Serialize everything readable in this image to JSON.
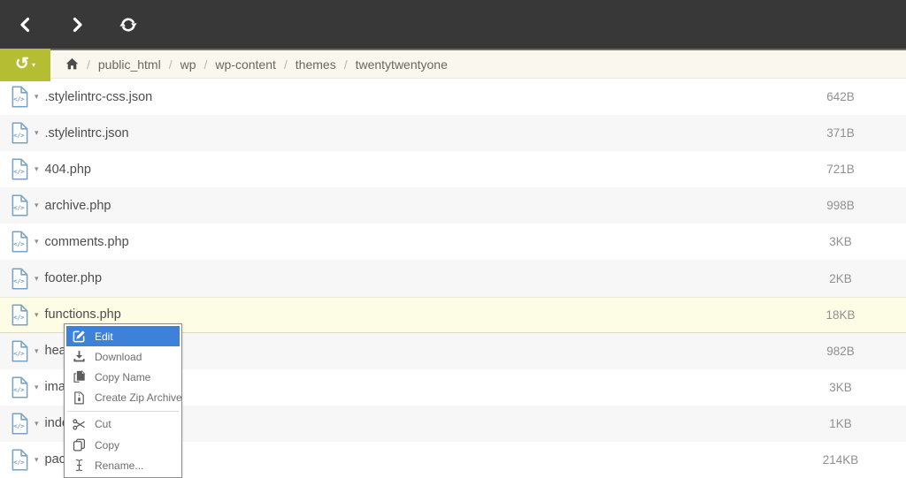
{
  "toolbar": {
    "buttons": [
      {
        "name": "back",
        "icon": "back-arrow-icon"
      },
      {
        "name": "forward",
        "icon": "forward-arrow-icon"
      },
      {
        "name": "refresh",
        "icon": "refresh-icon"
      }
    ]
  },
  "path_bar": {
    "history_button": {
      "icon": "history-icon",
      "caret": "▾"
    },
    "home_icon": "home-icon",
    "separator": "/",
    "segments": [
      "public_html",
      "wp",
      "wp-content",
      "themes",
      "twentytwentyone"
    ]
  },
  "file_list": {
    "caret_glyph": "▾",
    "rows": [
      {
        "name": ".stylelintrc-css.json",
        "size": "642B",
        "highlighted": false
      },
      {
        "name": ".stylelintrc.json",
        "size": "371B",
        "highlighted": false
      },
      {
        "name": "404.php",
        "size": "721B",
        "highlighted": false
      },
      {
        "name": "archive.php",
        "size": "998B",
        "highlighted": false
      },
      {
        "name": "comments.php",
        "size": "3KB",
        "highlighted": false
      },
      {
        "name": "footer.php",
        "size": "2KB",
        "highlighted": false
      },
      {
        "name": "functions.php",
        "size": "18KB",
        "highlighted": true
      },
      {
        "name": "head",
        "size": "982B",
        "highlighted": false
      },
      {
        "name": "imag",
        "size": "3KB",
        "highlighted": false
      },
      {
        "name": "inde",
        "size": "1KB",
        "highlighted": false
      },
      {
        "name": "pack",
        "size": "214KB",
        "highlighted": false
      }
    ]
  },
  "context_menu": {
    "items": [
      {
        "label": "Edit",
        "icon": "edit-icon",
        "active": true
      },
      {
        "label": "Download",
        "icon": "download-icon",
        "active": false
      },
      {
        "label": "Copy Name",
        "icon": "copy-name-icon",
        "active": false
      },
      {
        "label": "Create Zip Archive",
        "icon": "create-zip-archive-icon",
        "active": false
      },
      {
        "divider": true
      },
      {
        "label": "Cut",
        "icon": "cut-icon",
        "active": false
      },
      {
        "label": "Copy",
        "icon": "copy-icon",
        "active": false
      },
      {
        "label": "Rename...",
        "icon": "rename-icon",
        "active": false
      }
    ]
  },
  "colors": {
    "topbar_bg": "#383838",
    "accent_green": "#b5bd33",
    "breadcrumb_bg": "#f9f7ee",
    "row_alt_bg": "#f7f7f7",
    "highlight_row_bg": "#fdfce4",
    "menu_active_bg": "#3d82d8",
    "file_icon_blue": "#78a2c6"
  }
}
